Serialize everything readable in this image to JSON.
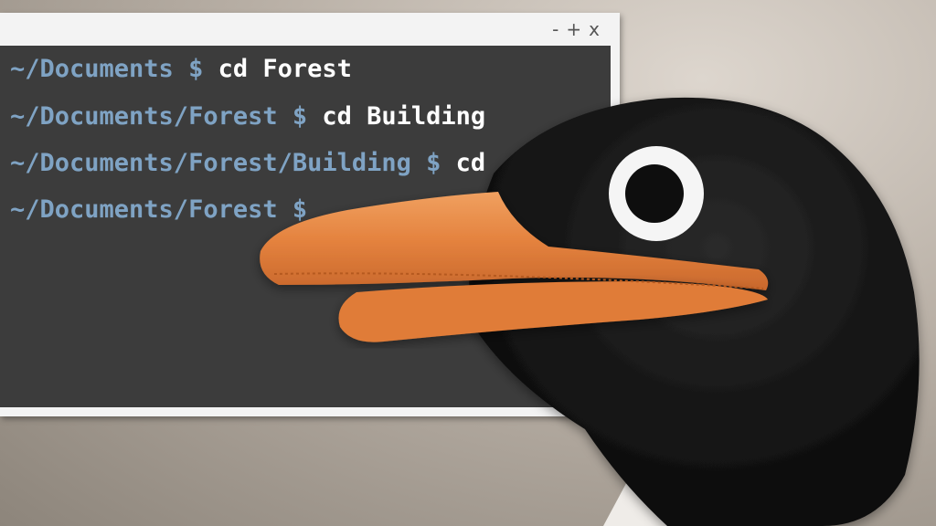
{
  "window": {
    "controls": [
      "-",
      "+",
      "x"
    ]
  },
  "terminal": {
    "lines": [
      {
        "prompt": "~/Documents $ ",
        "command": "cd Forest"
      },
      {
        "prompt": "~/Documents/Forest $ ",
        "command": "cd Building"
      },
      {
        "prompt": "~/Documents/Forest/Building $ ",
        "command": "cd .."
      },
      {
        "prompt": "~/Documents/Forest $ ",
        "command": ""
      }
    ]
  },
  "colors": {
    "terminal_bg": "#3c3c3c",
    "prompt": "#7fa3c4",
    "command": "#ffffff",
    "beak": "#e98a45",
    "penguin_head": "#141414"
  },
  "icons": [
    "minimize-icon",
    "maximize-icon",
    "close-icon"
  ]
}
